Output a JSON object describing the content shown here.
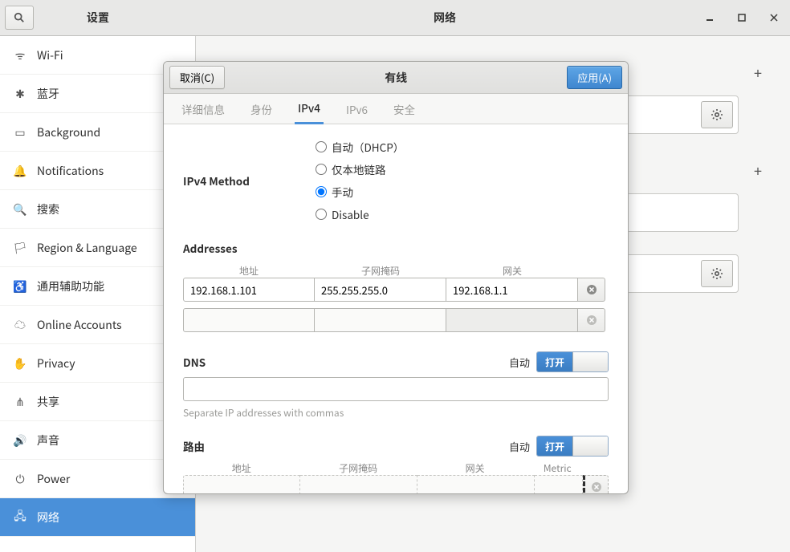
{
  "header": {
    "settings_title": "设置",
    "panel_title": "网络"
  },
  "sidebar": {
    "items": [
      {
        "icon": "wifi",
        "label": "Wi-Fi"
      },
      {
        "icon": "bluetooth",
        "label": "蓝牙"
      },
      {
        "icon": "background",
        "label": "Background"
      },
      {
        "icon": "notifications",
        "label": "Notifications"
      },
      {
        "icon": "search",
        "label": "搜索"
      },
      {
        "icon": "region",
        "label": "Region & Language"
      },
      {
        "icon": "accessibility",
        "label": "通用辅助功能"
      },
      {
        "icon": "online",
        "label": "Online Accounts"
      },
      {
        "icon": "privacy",
        "label": "Privacy"
      },
      {
        "icon": "sharing",
        "label": "共享"
      },
      {
        "icon": "sound",
        "label": "声音"
      },
      {
        "icon": "power",
        "label": "Power"
      },
      {
        "icon": "network",
        "label": "网络"
      }
    ],
    "active_index": 12
  },
  "dialog": {
    "cancel_label": "取消(C)",
    "apply_label": "应用(A)",
    "title": "有线",
    "tabs": {
      "details": "详细信息",
      "identity": "身份",
      "ipv4": "IPv4",
      "ipv6": "IPv6",
      "security": "安全",
      "active": "ipv4"
    },
    "ipv4": {
      "method_label": "IPv4 Method",
      "options": {
        "dhcp": "自动（DHCP）",
        "link_local": "仅本地链路",
        "manual": "手动",
        "disable": "Disable"
      },
      "selected": "manual",
      "addresses": {
        "title": "Addresses",
        "cols": {
          "addr": "地址",
          "mask": "子网掩码",
          "gw": "网关"
        },
        "rows": [
          {
            "addr": "192.168.1.101",
            "mask": "255.255.255.0",
            "gw": "192.168.1.1"
          },
          {
            "addr": "",
            "mask": "",
            "gw": ""
          }
        ]
      },
      "dns": {
        "title": "DNS",
        "auto_label": "自动",
        "switch_on_label": "打开",
        "value": "",
        "hint": "Separate IP addresses with commas"
      },
      "routes": {
        "title": "路由",
        "auto_label": "自动",
        "switch_on_label": "打开",
        "cols": {
          "addr": "地址",
          "mask": "子网掩码",
          "gw": "网关",
          "metric": "Metric"
        }
      }
    }
  }
}
